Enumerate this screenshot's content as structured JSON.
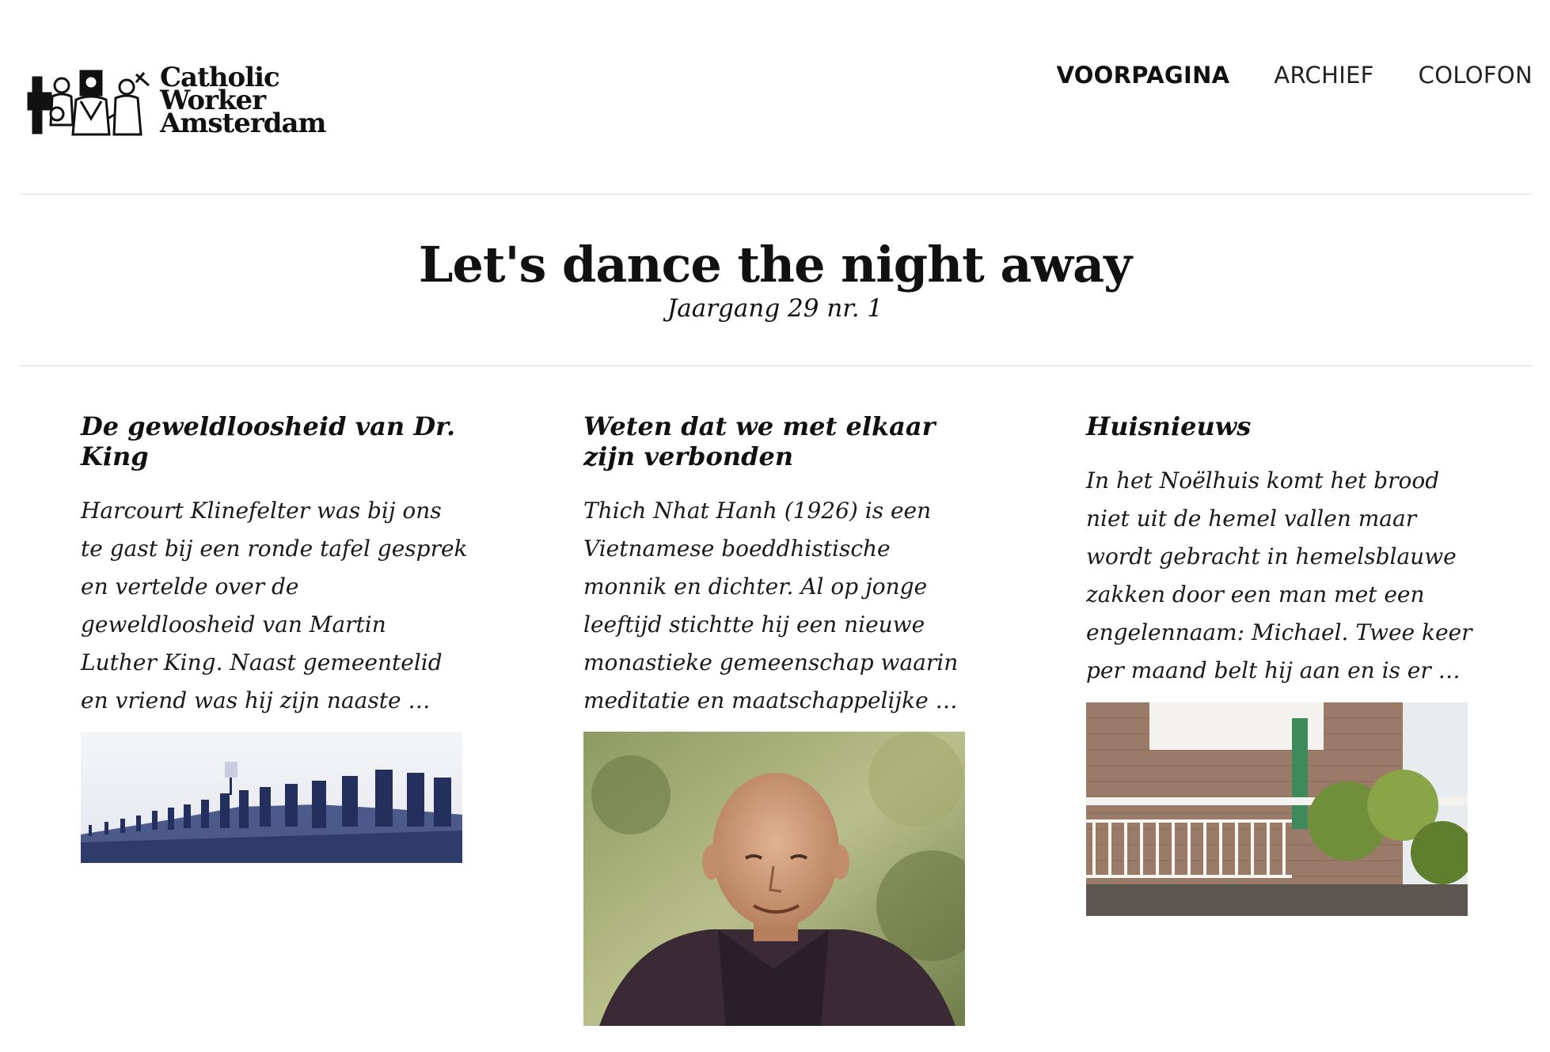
{
  "site": {
    "logo_lines": [
      "Catholic",
      "Worker",
      "Amsterdam"
    ]
  },
  "nav": {
    "items": [
      {
        "label": "VOORPAGINA",
        "active": true
      },
      {
        "label": "ARCHIEF",
        "active": false
      },
      {
        "label": "COLOFON",
        "active": false
      }
    ]
  },
  "issue": {
    "title": "Let's dance the night away",
    "subtitle": "Jaargang 29 nr. 1"
  },
  "articles": [
    {
      "title": "De geweldloosheid van Dr. King",
      "excerpt": "Harcourt Klinefelter was bij ons te gast bij een ronde tafel gesprek en vertelde over de geweldloosheid van Martin Luther King. Naast gemeentelid en vriend was hij zijn naaste …"
    },
    {
      "title": "Weten dat we met elkaar zijn verbonden",
      "excerpt": "Thich Nhat Hanh (1926) is een Vietnamese boeddhistische monnik en dichter. Al op jonge leeftijd stichtte hij een nieuwe monastieke gemeenschap waarin meditatie en maatschappelijke …"
    },
    {
      "title": "Huisnieuws",
      "excerpt": "In het Noëlhuis komt het brood niet uit de hemel vallen maar wordt gebracht in hemelsblauwe zakken door een man met een engelennaam: Michael. Twee keer per maand belt hij aan en is er …"
    }
  ]
}
